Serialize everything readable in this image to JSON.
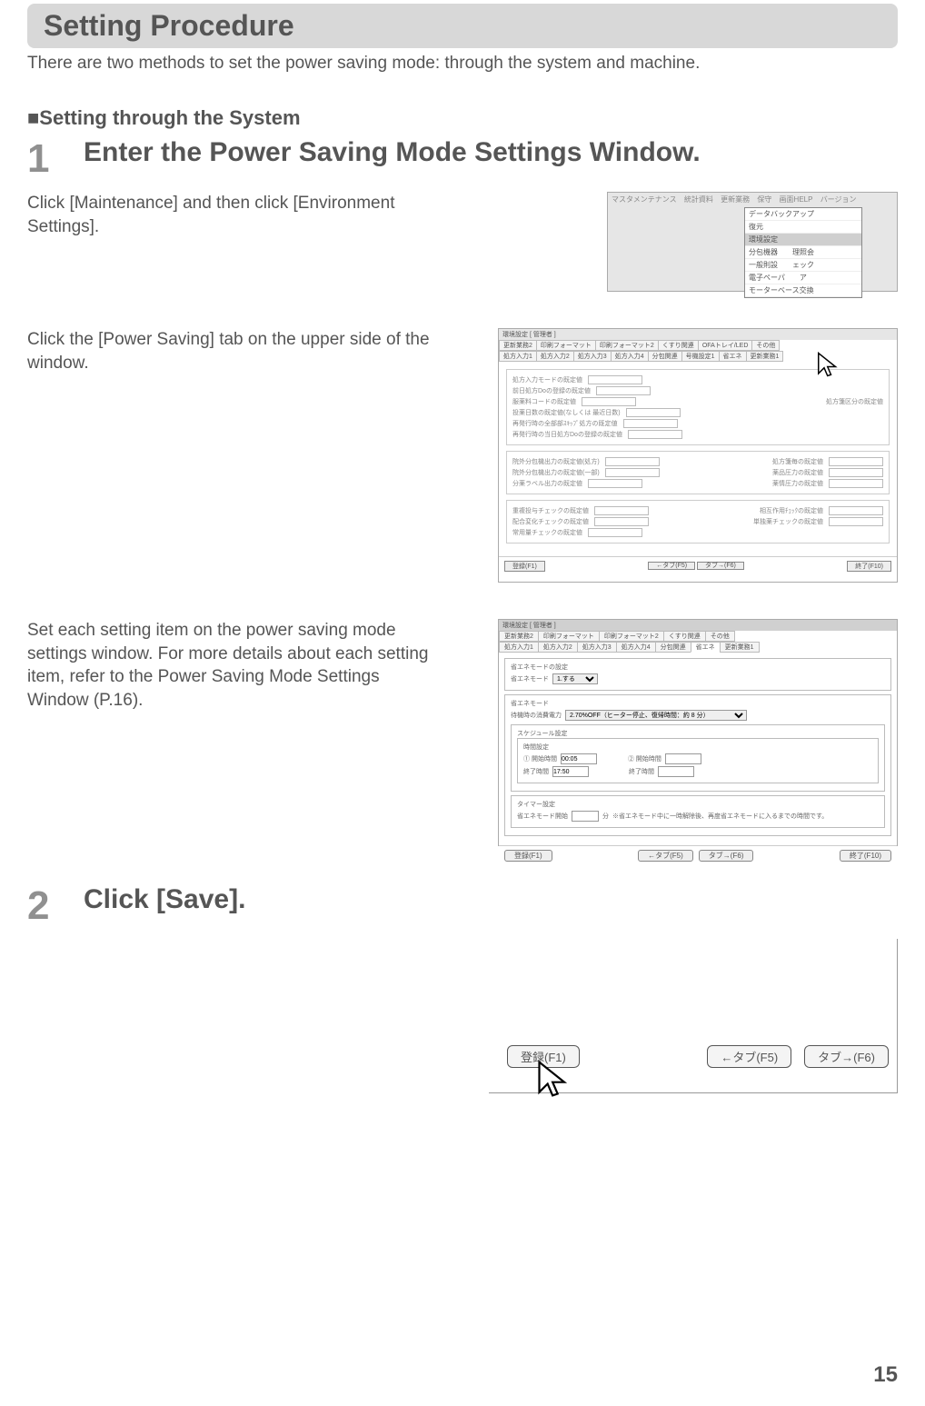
{
  "header": {
    "title": "Setting Procedure"
  },
  "intro": "There are two methods to set the power saving mode: through the system and machine.",
  "subhead": "■Setting through the System",
  "step1": {
    "num": "1",
    "title": "Enter the Power Saving Mode Settings Window.",
    "sub1": "Click [Maintenance] and then click [Environment Settings].",
    "sub2": "Click the [Power Saving] tab on the upper side of the window.",
    "sub3": "Set each setting item on the power saving mode settings window. For more details about each setting item, refer to the Power Saving Mode Settings Window (P.16)."
  },
  "step2": {
    "num": "2",
    "title": "Click [Save]."
  },
  "ss1": {
    "menubar": [
      "マスタメンテナンス",
      "統計資料",
      "更新業務",
      "保守",
      "画面HELP",
      "バージョン"
    ],
    "dropdown": [
      "データバックアップ",
      "復元",
      "環境設定",
      "分包機器　　理照会",
      "一般則設　　ェック",
      "電子ペーパ　　ア",
      "モーターベース交換"
    ]
  },
  "ss2": {
    "title": "環境設定 [ 管理者 ]",
    "tabsRow1": [
      "更新業務2",
      "印刷フォーマット",
      "印刷フォーマット2",
      "くすり関連",
      "OFAトレイ/LED",
      "その他"
    ],
    "tabsRow2": [
      "処方入力1",
      "処方入力2",
      "処方入力3",
      "処方入力4",
      "分包関連",
      "号機設定1",
      "省エネ",
      "更新業務1"
    ],
    "buttons": {
      "save": "登録(F1)",
      "prev": "←タブ(F5)",
      "next": "タブ→(F6)",
      "close": "終了(F10)"
    }
  },
  "ss3": {
    "title": "環境設定 [ 管理者 ]",
    "tabsRow1": [
      "更新業務2",
      "印刷フォーマット",
      "印刷フォーマット2",
      "くすり関連",
      "その他"
    ],
    "tabsRow2": [
      "処方入力1",
      "処方入力2",
      "処方入力3",
      "処方入力4",
      "分包関連",
      "省エネ",
      "更新業務1"
    ],
    "fs_mode": {
      "legend": "省エネモードの設定",
      "label": "省エネモード",
      "value": "1.する"
    },
    "fs_eco": {
      "legend": "省エネモード",
      "power_label": "待機時の消費電力",
      "power_value": "2.70%OFF（ヒーター停止、復帰時間：約 8 分）"
    },
    "fs_schedule": {
      "legend": "スケジュール設定",
      "inner_legend": "時間設定",
      "start1_label": "① 開始時間",
      "start1": "00:05",
      "end1_label": "終了時間",
      "end1": "17:50",
      "start2_label": "② 開始時間",
      "start2": "",
      "end2_label": "終了時間",
      "end2": ""
    },
    "fs_timer": {
      "legend": "タイマー設定",
      "label": "省エネモード開始",
      "unit": "分",
      "note": "※省エネモード中に一時解除後、再度省エネモードに入るまでの時間です。"
    },
    "buttons": {
      "save": "登録(F1)",
      "prev": "←タブ(F5)",
      "next": "タブ→(F6)",
      "close": "終了(F10)"
    }
  },
  "ss4": {
    "save": "登録(F1)",
    "prev": "←タブ(F5)",
    "next": "タブ→(F6)"
  },
  "page_number": "15"
}
